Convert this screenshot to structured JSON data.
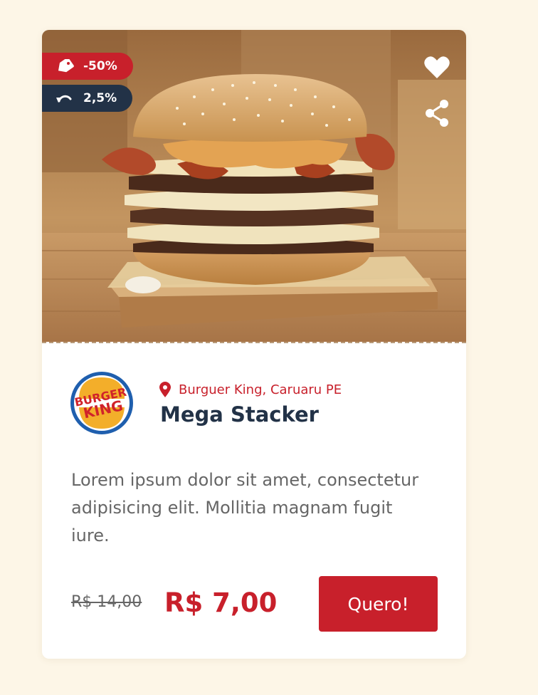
{
  "offer": {
    "discount_label": "-50%",
    "cashback_label": "2,5%",
    "location": "Burguer King, Caruaru PE",
    "title": "Mega Stacker",
    "description": "Lorem ipsum dolor sit amet, consectetur adipisicing elit. Mollitia magnam fugit iure.",
    "old_price": "R$ 14,00",
    "new_price": "R$ 7,00",
    "cta_label": "Quero!"
  },
  "brand": {
    "logo_text_top": "BURGER",
    "logo_text_bottom": "KING"
  },
  "icons": {
    "discount": "tag-icon",
    "cashback": "undo-icon",
    "favorite": "heart-icon",
    "share": "share-icon",
    "location": "map-pin-icon"
  },
  "colors": {
    "accent": "#c8202b",
    "navy": "#223247",
    "page_background": "#fdf6e7"
  }
}
